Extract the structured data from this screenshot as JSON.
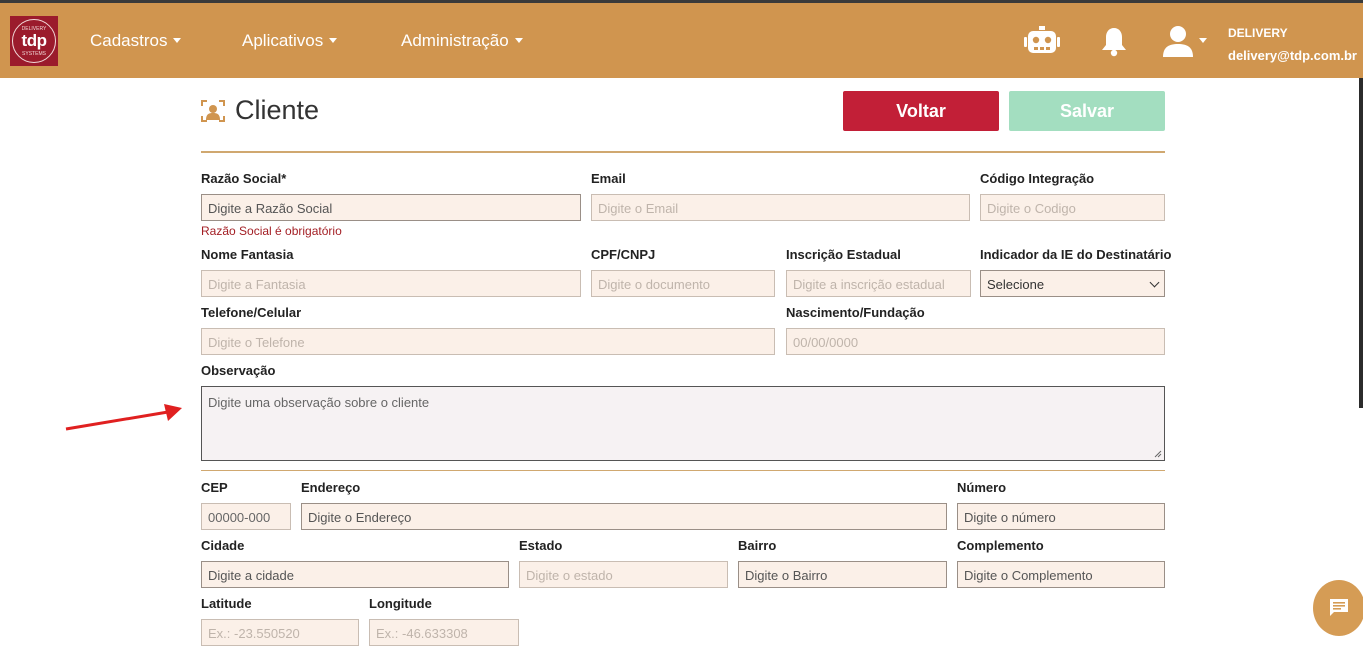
{
  "colors": {
    "navbar": "#d0954f",
    "brand": "#9b1b2c",
    "back_button": "#c21f37",
    "save_button": "#a3dec0",
    "error": "#a31e24"
  },
  "brand": {
    "logo_text": "tdp",
    "logo_arc_top": "DELIVERY",
    "logo_arc_bottom": "SYSTEMS"
  },
  "nav": {
    "menus": [
      {
        "label": "Cadastros"
      },
      {
        "label": "Aplicativos"
      },
      {
        "label": "Administração"
      }
    ],
    "icons": [
      "robot-icon",
      "bell-icon",
      "user-icon"
    ],
    "user": {
      "name": "DELIVERY",
      "email": "delivery@tdp.com.br"
    }
  },
  "page": {
    "title": "Cliente",
    "back_label": "Voltar",
    "save_label": "Salvar"
  },
  "form": {
    "razao_social": {
      "label": "Razão Social*",
      "placeholder": "Digite a Razão Social",
      "error": "Razão Social é obrigatório"
    },
    "email": {
      "label": "Email",
      "placeholder": "Digite o Email"
    },
    "codigo": {
      "label": "Código Integração",
      "placeholder": "Digite o Codigo"
    },
    "fantasia": {
      "label": "Nome Fantasia",
      "placeholder": "Digite a Fantasia"
    },
    "cpf": {
      "label": "CPF/CNPJ",
      "placeholder": "Digite o documento"
    },
    "ie": {
      "label": "Inscrição Estadual",
      "placeholder": "Digite a inscrição estadual"
    },
    "indicador": {
      "label": "Indicador da IE do Destinatário",
      "selected": "Selecione"
    },
    "telefone": {
      "label": "Telefone/Celular",
      "placeholder": "Digite o Telefone"
    },
    "nascimento": {
      "label": "Nascimento/Fundação",
      "placeholder": "00/00/0000"
    },
    "observacao": {
      "label": "Observação",
      "placeholder": "Digite uma observação sobre o cliente"
    },
    "cep": {
      "label": "CEP",
      "placeholder": "00000-000"
    },
    "endereco": {
      "label": "Endereço",
      "placeholder": "Digite o Endereço"
    },
    "numero": {
      "label": "Número",
      "placeholder": "Digite o número"
    },
    "cidade": {
      "label": "Cidade",
      "placeholder": "Digite a cidade"
    },
    "estado": {
      "label": "Estado",
      "placeholder": "Digite o estado"
    },
    "bairro": {
      "label": "Bairro",
      "placeholder": "Digite o Bairro"
    },
    "complemento": {
      "label": "Complemento",
      "placeholder": "Digite o Complemento"
    },
    "latitude": {
      "label": "Latitude",
      "placeholder": "Ex.: -23.550520"
    },
    "longitude": {
      "label": "Longitude",
      "placeholder": "Ex.: -46.633308"
    }
  }
}
